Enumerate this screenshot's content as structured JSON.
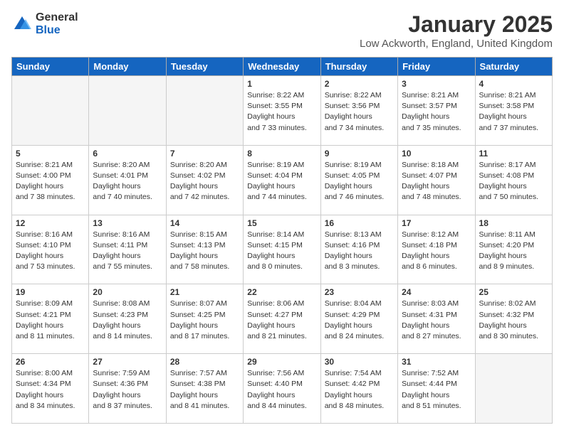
{
  "logo": {
    "general": "General",
    "blue": "Blue"
  },
  "header": {
    "title": "January 2025",
    "subtitle": "Low Ackworth, England, United Kingdom"
  },
  "days_of_week": [
    "Sunday",
    "Monday",
    "Tuesday",
    "Wednesday",
    "Thursday",
    "Friday",
    "Saturday"
  ],
  "weeks": [
    [
      {
        "day": "",
        "empty": true
      },
      {
        "day": "",
        "empty": true
      },
      {
        "day": "",
        "empty": true
      },
      {
        "day": "1",
        "sunrise": "8:22 AM",
        "sunset": "3:55 PM",
        "daylight": "7 hours and 33 minutes."
      },
      {
        "day": "2",
        "sunrise": "8:22 AM",
        "sunset": "3:56 PM",
        "daylight": "7 hours and 34 minutes."
      },
      {
        "day": "3",
        "sunrise": "8:21 AM",
        "sunset": "3:57 PM",
        "daylight": "7 hours and 35 minutes."
      },
      {
        "day": "4",
        "sunrise": "8:21 AM",
        "sunset": "3:58 PM",
        "daylight": "7 hours and 37 minutes."
      }
    ],
    [
      {
        "day": "5",
        "sunrise": "8:21 AM",
        "sunset": "4:00 PM",
        "daylight": "7 hours and 38 minutes."
      },
      {
        "day": "6",
        "sunrise": "8:20 AM",
        "sunset": "4:01 PM",
        "daylight": "7 hours and 40 minutes."
      },
      {
        "day": "7",
        "sunrise": "8:20 AM",
        "sunset": "4:02 PM",
        "daylight": "7 hours and 42 minutes."
      },
      {
        "day": "8",
        "sunrise": "8:19 AM",
        "sunset": "4:04 PM",
        "daylight": "7 hours and 44 minutes."
      },
      {
        "day": "9",
        "sunrise": "8:19 AM",
        "sunset": "4:05 PM",
        "daylight": "7 hours and 46 minutes."
      },
      {
        "day": "10",
        "sunrise": "8:18 AM",
        "sunset": "4:07 PM",
        "daylight": "7 hours and 48 minutes."
      },
      {
        "day": "11",
        "sunrise": "8:17 AM",
        "sunset": "4:08 PM",
        "daylight": "7 hours and 50 minutes."
      }
    ],
    [
      {
        "day": "12",
        "sunrise": "8:16 AM",
        "sunset": "4:10 PM",
        "daylight": "7 hours and 53 minutes."
      },
      {
        "day": "13",
        "sunrise": "8:16 AM",
        "sunset": "4:11 PM",
        "daylight": "7 hours and 55 minutes."
      },
      {
        "day": "14",
        "sunrise": "8:15 AM",
        "sunset": "4:13 PM",
        "daylight": "7 hours and 58 minutes."
      },
      {
        "day": "15",
        "sunrise": "8:14 AM",
        "sunset": "4:15 PM",
        "daylight": "8 hours and 0 minutes."
      },
      {
        "day": "16",
        "sunrise": "8:13 AM",
        "sunset": "4:16 PM",
        "daylight": "8 hours and 3 minutes."
      },
      {
        "day": "17",
        "sunrise": "8:12 AM",
        "sunset": "4:18 PM",
        "daylight": "8 hours and 6 minutes."
      },
      {
        "day": "18",
        "sunrise": "8:11 AM",
        "sunset": "4:20 PM",
        "daylight": "8 hours and 9 minutes."
      }
    ],
    [
      {
        "day": "19",
        "sunrise": "8:09 AM",
        "sunset": "4:21 PM",
        "daylight": "8 hours and 11 minutes."
      },
      {
        "day": "20",
        "sunrise": "8:08 AM",
        "sunset": "4:23 PM",
        "daylight": "8 hours and 14 minutes."
      },
      {
        "day": "21",
        "sunrise": "8:07 AM",
        "sunset": "4:25 PM",
        "daylight": "8 hours and 17 minutes."
      },
      {
        "day": "22",
        "sunrise": "8:06 AM",
        "sunset": "4:27 PM",
        "daylight": "8 hours and 21 minutes."
      },
      {
        "day": "23",
        "sunrise": "8:04 AM",
        "sunset": "4:29 PM",
        "daylight": "8 hours and 24 minutes."
      },
      {
        "day": "24",
        "sunrise": "8:03 AM",
        "sunset": "4:31 PM",
        "daylight": "8 hours and 27 minutes."
      },
      {
        "day": "25",
        "sunrise": "8:02 AM",
        "sunset": "4:32 PM",
        "daylight": "8 hours and 30 minutes."
      }
    ],
    [
      {
        "day": "26",
        "sunrise": "8:00 AM",
        "sunset": "4:34 PM",
        "daylight": "8 hours and 34 minutes."
      },
      {
        "day": "27",
        "sunrise": "7:59 AM",
        "sunset": "4:36 PM",
        "daylight": "8 hours and 37 minutes."
      },
      {
        "day": "28",
        "sunrise": "7:57 AM",
        "sunset": "4:38 PM",
        "daylight": "8 hours and 41 minutes."
      },
      {
        "day": "29",
        "sunrise": "7:56 AM",
        "sunset": "4:40 PM",
        "daylight": "8 hours and 44 minutes."
      },
      {
        "day": "30",
        "sunrise": "7:54 AM",
        "sunset": "4:42 PM",
        "daylight": "8 hours and 48 minutes."
      },
      {
        "day": "31",
        "sunrise": "7:52 AM",
        "sunset": "4:44 PM",
        "daylight": "8 hours and 51 minutes."
      },
      {
        "day": "",
        "empty": true
      }
    ]
  ]
}
